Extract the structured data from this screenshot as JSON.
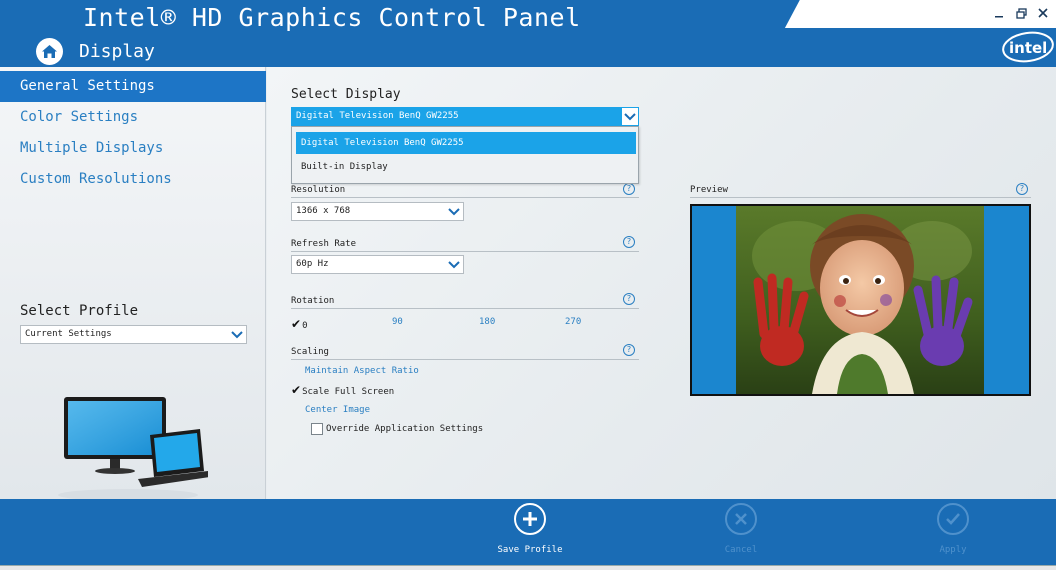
{
  "app": {
    "title": "Intel® HD Graphics Control Panel",
    "page": "Display",
    "window_controls": [
      "minimize-icon",
      "restore-icon",
      "close-icon"
    ],
    "logo_text": "intel"
  },
  "sidebar": {
    "items": [
      {
        "label": "General Settings",
        "active": true
      },
      {
        "label": "Color Settings",
        "active": false
      },
      {
        "label": "Multiple Displays",
        "active": false
      },
      {
        "label": "Custom Resolutions",
        "active": false
      }
    ],
    "profile_label": "Select Profile",
    "profile_value": "Current Settings"
  },
  "display": {
    "label": "Select Display",
    "selected": "Digital Television BenQ GW2255",
    "options": [
      "Digital Television BenQ GW2255",
      "Built-in Display"
    ]
  },
  "resolution": {
    "label": "Resolution",
    "value": "1366 x 768"
  },
  "refresh": {
    "label": "Refresh Rate",
    "value": "60p Hz"
  },
  "rotation": {
    "label": "Rotation",
    "options": [
      "0",
      "90",
      "180",
      "270"
    ],
    "selected": "0"
  },
  "scaling": {
    "label": "Scaling",
    "options": [
      {
        "label": "Maintain Aspect Ratio",
        "checked": false
      },
      {
        "label": "Scale Full Screen",
        "checked": true
      },
      {
        "label": "Center Image",
        "checked": false
      }
    ],
    "override_label": "Override Application Settings",
    "override_checked": false
  },
  "preview": {
    "label": "Preview"
  },
  "help_glyph": "?",
  "check_glyph": "✔",
  "footer": {
    "save": "Save Profile",
    "cancel": "Cancel",
    "apply": "Apply"
  },
  "colors": {
    "brand_blue": "#1a6cb5",
    "accent": "#1ba3e8",
    "link": "#2a7fc2"
  }
}
